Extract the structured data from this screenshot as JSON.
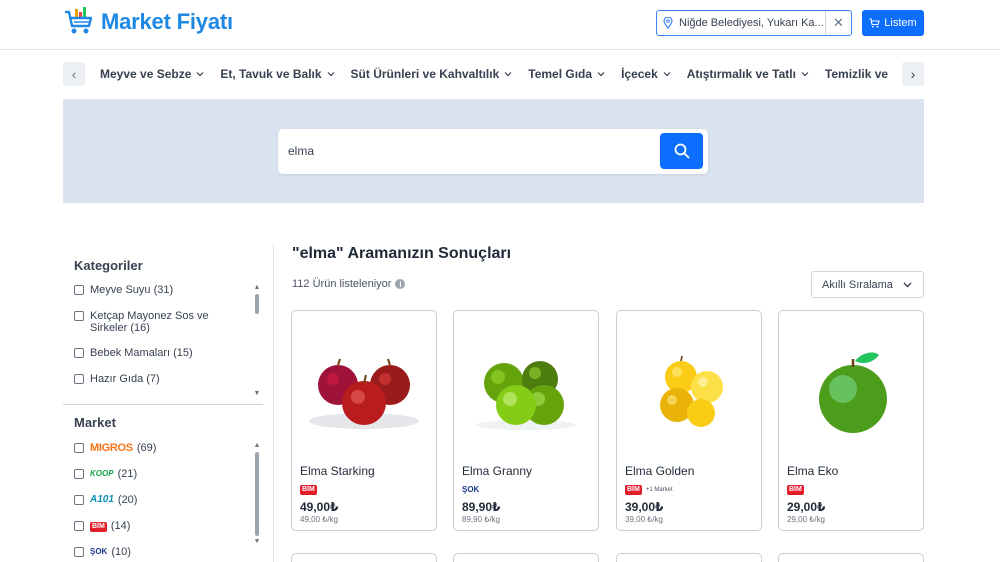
{
  "header": {
    "logo_text": "Market Fiyatı",
    "location_text": "Niğde Belediyesi, Yukarı Ka...",
    "listem_label": "Listem"
  },
  "categories": [
    "Meyve ve Sebze",
    "Et, Tavuk ve Balık",
    "Süt Ürünleri ve Kahvaltılık",
    "Temel Gıda",
    "İçecek",
    "Atıştırmalık ve Tatlı",
    "Temizlik ve"
  ],
  "search": {
    "value": "elma"
  },
  "sidebar": {
    "categories_title": "Kategoriler",
    "category_filters": [
      {
        "label": "Meyve Suyu (31)"
      },
      {
        "label": "Ketçap Mayonez Sos ve Sirkeler (16)"
      },
      {
        "label": "Bebek Mamaları (15)"
      },
      {
        "label": "Hazır Gıda (7)"
      }
    ],
    "market_title": "Market",
    "market_filters": [
      {
        "logo": "MIGROS",
        "count": "(69)"
      },
      {
        "logo": "KOOP",
        "count": "(21)"
      },
      {
        "logo": "A101",
        "count": "(20)"
      },
      {
        "logo": "BİM",
        "count": "(14)"
      },
      {
        "logo": "ŞOK",
        "count": "(10)"
      }
    ]
  },
  "results": {
    "title": "\"elma\" Aramanızın Sonuçları",
    "count_text": "112 Ürün listeleniyor",
    "sort_label": "Akıllı Sıralama"
  },
  "products": [
    {
      "name": "Elma Starking",
      "market": "BİM",
      "extra": "",
      "price": "49,00₺",
      "unit_price": "49,00 ₺/kg",
      "color": "#b91c1c"
    },
    {
      "name": "Elma Granny",
      "market": "ŞOK",
      "extra": "",
      "price": "89,90₺",
      "unit_price": "89,90 ₺/kg",
      "color": "#65a30d"
    },
    {
      "name": "Elma Golden",
      "market": "BİM",
      "extra": "+1 Market",
      "price": "39,00₺",
      "unit_price": "39,00 ₺/kg",
      "color": "#eab308"
    },
    {
      "name": "Elma Eko",
      "market": "BİM",
      "extra": "",
      "price": "29,00₺",
      "unit_price": "29,00 ₺/kg",
      "color": "#4d9d1c"
    }
  ]
}
